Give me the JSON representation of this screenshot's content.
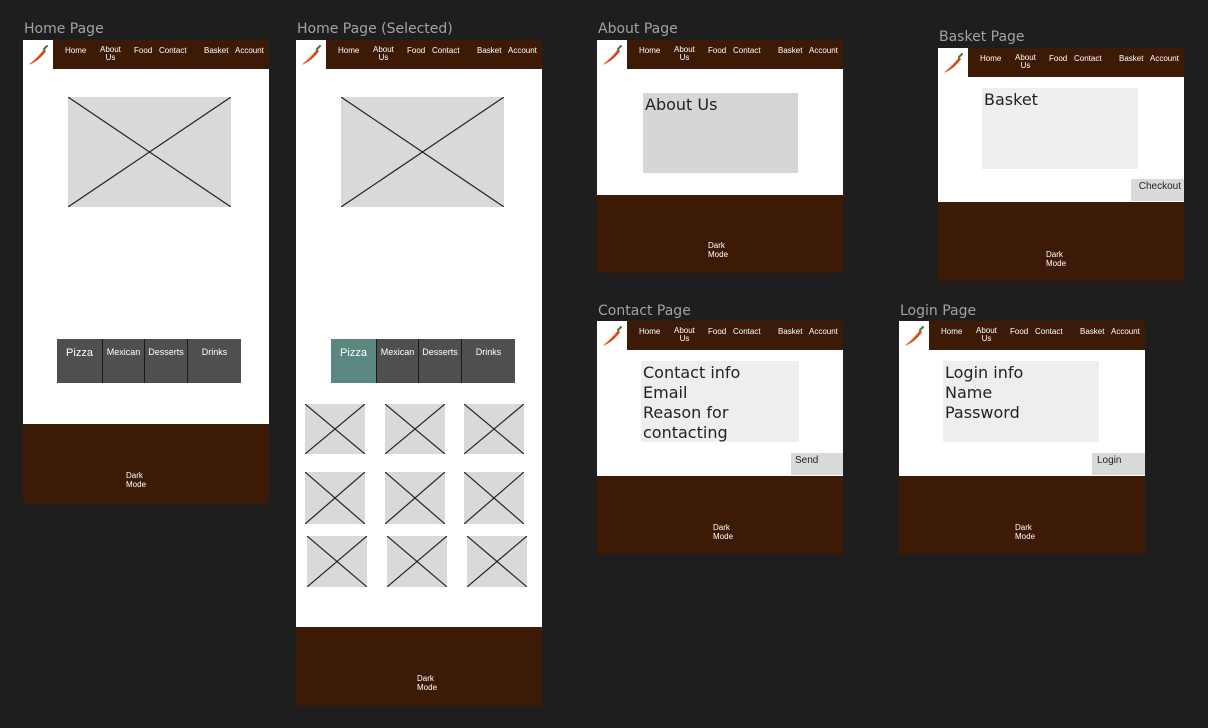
{
  "nav": {
    "home": "Home",
    "about_line1": "About",
    "about_line2": "Us",
    "food": "Food",
    "contact": "Contact",
    "basket": "Basket",
    "account": "Account"
  },
  "footer": {
    "dark_mode_line1": "Dark",
    "dark_mode_line2": "Mode"
  },
  "frames": {
    "home": {
      "label": "Home Page"
    },
    "home_selected": {
      "label": "Home Page (Selected)"
    },
    "about": {
      "label": "About Page",
      "panel_text": "About Us"
    },
    "basket": {
      "label": "Basket Page",
      "panel_text": "Basket",
      "button": "Checkout"
    },
    "contact": {
      "label": "Contact Page",
      "lines": [
        "Contact info",
        "Email",
        "Reason for",
        "contacting"
      ],
      "button": "Send"
    },
    "login": {
      "label": "Login Page",
      "lines": [
        "Login info",
        "Name",
        "Password"
      ],
      "button": "Login"
    }
  },
  "categories": [
    "Pizza",
    "Mexican",
    "Desserts",
    "Drinks"
  ],
  "colors": {
    "canvas": "#1e1e1e",
    "brand_brown": "#3c1a05",
    "category_button": "#4f4f4f",
    "category_selected": "#5b8781",
    "placeholder": "#d9d9d9"
  },
  "icons": {
    "logo": "chili-pepper-icon",
    "image": "image-placeholder-icon"
  }
}
